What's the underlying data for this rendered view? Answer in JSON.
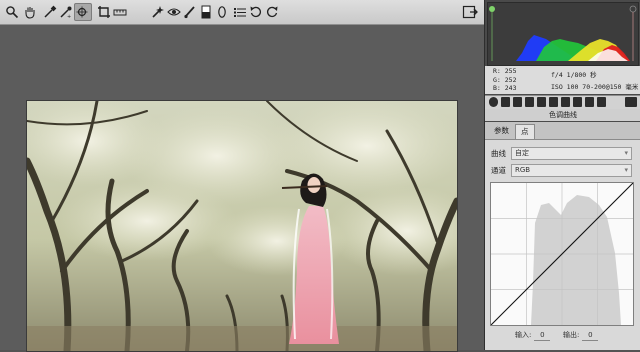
{
  "toolbar": {
    "tools": [
      {
        "name": "zoom-icon"
      },
      {
        "name": "hand-icon"
      },
      {
        "name": "white-balance-icon"
      },
      {
        "name": "color-sampler-icon"
      },
      {
        "name": "targeted-adjust-icon"
      },
      {
        "name": "crop-icon"
      },
      {
        "name": "straighten-icon"
      },
      {
        "name": "spot-removal-icon"
      },
      {
        "name": "red-eye-icon"
      },
      {
        "name": "adjustment-brush-icon"
      },
      {
        "name": "graduated-filter-icon"
      },
      {
        "name": "radial-filter-icon"
      },
      {
        "name": "preferences-icon"
      },
      {
        "name": "rotate-left-icon"
      },
      {
        "name": "rotate-right-icon"
      }
    ],
    "selected_tool": "targeted-adjust-icon"
  },
  "info": {
    "r": "R:  255",
    "g": "G:  252",
    "b": "B:  243",
    "aperture_shutter": "f/4   1/800 秒",
    "iso_lens": "ISO 100   70-200@150 毫米"
  },
  "panel": {
    "section_title": "色调曲线",
    "tabs": [
      "参数",
      "点"
    ],
    "active_tab": "点",
    "curve_label": "曲线",
    "curve_value": "自定",
    "channel_label": "通道",
    "channel_value": "RGB",
    "input_label": "输入:",
    "input_value": "0",
    "output_label": "输出:",
    "output_value": "0"
  },
  "colors": {
    "accent": "#7fd36a",
    "panel_bg": "#4a4a4a",
    "canvas_bg": "#5c5c5c"
  }
}
